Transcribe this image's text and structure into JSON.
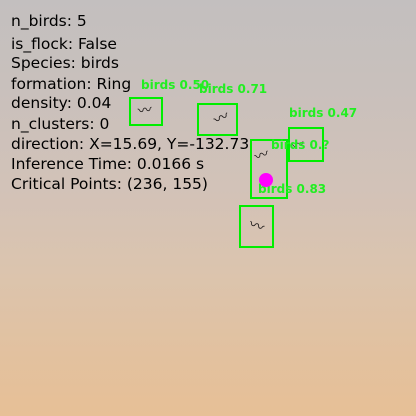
{
  "detections": [
    {
      "label": "birds 0.50"
    },
    {
      "label": "birds 0.71"
    },
    {
      "label": "birds 0.47"
    },
    {
      "label": "birds 0.?"
    },
    {
      "label": "birds 0.83"
    }
  ],
  "overlay": {
    "n_birds": "n_birds: 5",
    "is_flock": "is_flock: False",
    "species": "Species: birds",
    "formation": "formation: Ring",
    "density": "density: 0.04",
    "n_clusters": "n_clusters: 0",
    "direction": "direction: X=15.69, Y=-132.73",
    "inference_time": "Inference Time: 0.0166 s",
    "critical_points": "Critical Points: (236, 155)"
  },
  "colors": {
    "box": "#00ee00",
    "critical_point": "#ff00ff",
    "text": "#000000"
  }
}
